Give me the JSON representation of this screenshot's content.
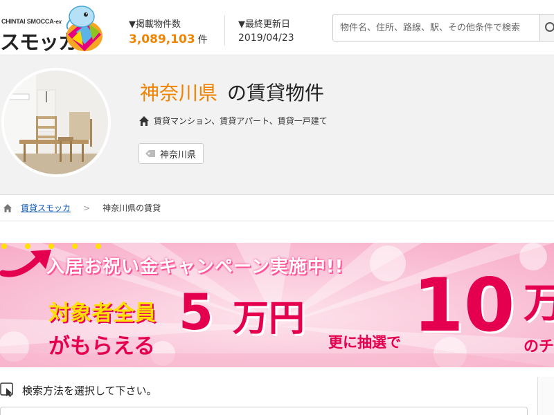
{
  "header": {
    "logo_small": "CHINTAI SMOCCA-",
    "logo_small_suffix": "ex",
    "logo_main": "スモッカ",
    "listings_label": "▼掲載物件数",
    "listings_count": "3,089,103",
    "listings_unit": "件",
    "updated_label": "▼最終更新日",
    "updated_date": "2019/04/23",
    "search_placeholder": "物件名、住所、路線、駅、その他条件で検索"
  },
  "hero": {
    "prefecture": "神奈川県",
    "title_suffix": "の賃貸物件",
    "property_types": "賃貸マンション、賃貸アパート、賃貸一戸建て",
    "tag": "神奈川県"
  },
  "breadcrumb": {
    "home_link": "賃貸スモッカ",
    "separator": ">",
    "current": "神奈川県の賃貸"
  },
  "banner": {
    "headline": "入居お祝い金キャンペーン実施中!!",
    "target": "対象者全員",
    "get": "がもらえる",
    "amount1": "5",
    "amount1_unit": "万円",
    "lottery": "更に抽選で",
    "amount2": "10",
    "amount2_unit": "万",
    "tail": "のチ"
  },
  "search_method": {
    "label": "検索方法を選択して下さい。"
  },
  "colors": {
    "accent": "#f08300",
    "link": "#0a58b5",
    "banner_pink": "#e4004f"
  }
}
